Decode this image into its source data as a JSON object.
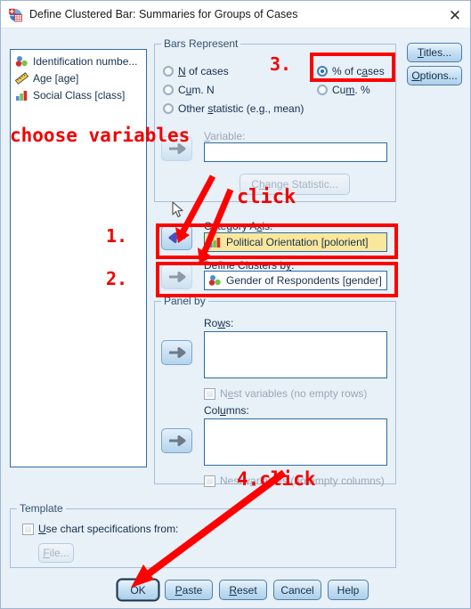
{
  "window": {
    "title": "Define Clustered Bar: Summaries for Groups of Cases",
    "icon": "spss-chart-icon",
    "close_label": "✕"
  },
  "variable_list": {
    "name": "source-variable-list",
    "items": [
      {
        "label": "Identification numbe...",
        "icon": "nominal-icon"
      },
      {
        "label": "Age [age]",
        "icon": "scale-ruler-icon"
      },
      {
        "label": "Social Class [class]",
        "icon": "ordinal-bar-icon"
      }
    ]
  },
  "bars_represent": {
    "title": "Bars Represent",
    "options": [
      {
        "label_pre": "",
        "accel": "N",
        "label_post": " of cases",
        "selected": false
      },
      {
        "label_pre": "C",
        "accel": "u",
        "label_post": "m. N",
        "selected": false
      },
      {
        "label_pre": "Other ",
        "accel": "s",
        "label_post": "tatistic (e.g., mean)",
        "selected": false
      },
      {
        "label_pre": "% of c",
        "accel": "a",
        "label_post": "ses",
        "selected": true
      },
      {
        "label_pre": "Cu",
        "accel": "m",
        "label_post": ". %",
        "selected": false
      }
    ],
    "variable_label_pre": "",
    "variable_accel": "V",
    "variable_label_post": "ariable:",
    "variable_value": "",
    "change_statistic_pre": "C",
    "change_statistic_accel": "h",
    "change_statistic_post": "ange Statistic...",
    "change_statistic_enabled": false
  },
  "category_axis": {
    "label_pre": "Category A",
    "label_accel": "x",
    "label_post": "is:",
    "value": "Political Orientation [polorient]",
    "value_icon": "ordinal-bar-icon",
    "highlighted": true,
    "arrow_direction": "left"
  },
  "define_clusters": {
    "label_pre": "Define Clusters b",
    "label_accel": "y",
    "label_post": ":",
    "value": "Gender of Respondents [gender]",
    "value_icon": "nominal-icon",
    "highlighted": false,
    "arrow_direction": "right"
  },
  "panel_by": {
    "title": "Panel by",
    "rows_label_pre": "Ro",
    "rows_label_accel": "w",
    "rows_label_post": "s:",
    "rows_value": "",
    "nest_rows_pre": "N",
    "nest_rows_accel": "e",
    "nest_rows_post": "st variables (no empty rows)",
    "nest_rows_checked": false,
    "columns_label_pre": "Col",
    "columns_label_accel": "u",
    "columns_label_post": "mns:",
    "columns_value": "",
    "nest_columns_pre": "Nest v",
    "nest_columns_accel": "a",
    "nest_columns_post": "riables (no empty columns)",
    "nest_columns_checked": false
  },
  "template": {
    "title": "Template",
    "checkbox_pre": "",
    "checkbox_accel": "U",
    "checkbox_post": "se chart specifications from:",
    "checkbox_checked": false,
    "file_button_pre": "",
    "file_button_accel": "F",
    "file_button_post": "ile...",
    "file_button_enabled": false
  },
  "side_buttons": [
    {
      "pre": "",
      "accel": "T",
      "post": "itles...",
      "name": "titles-button"
    },
    {
      "pre": "",
      "accel": "O",
      "post": "ptions...",
      "name": "options-button"
    }
  ],
  "footer_buttons": [
    {
      "pre": "OK",
      "accel": "",
      "post": "",
      "name": "ok-button",
      "default": true
    },
    {
      "pre": "",
      "accel": "P",
      "post": "aste",
      "name": "paste-button",
      "default": false
    },
    {
      "pre": "",
      "accel": "R",
      "post": "eset",
      "name": "reset-button",
      "default": false
    },
    {
      "pre": "Cancel",
      "accel": "",
      "post": "",
      "name": "cancel-button",
      "default": false
    },
    {
      "pre": "Help",
      "accel": "",
      "post": "",
      "name": "help-button",
      "default": false
    }
  ],
  "annotations": {
    "color": "#ff0000",
    "choose_variables": "choose variables",
    "click": "click",
    "step1": "1.",
    "step2": "2.",
    "step3": "3.",
    "step4": "4.click"
  }
}
